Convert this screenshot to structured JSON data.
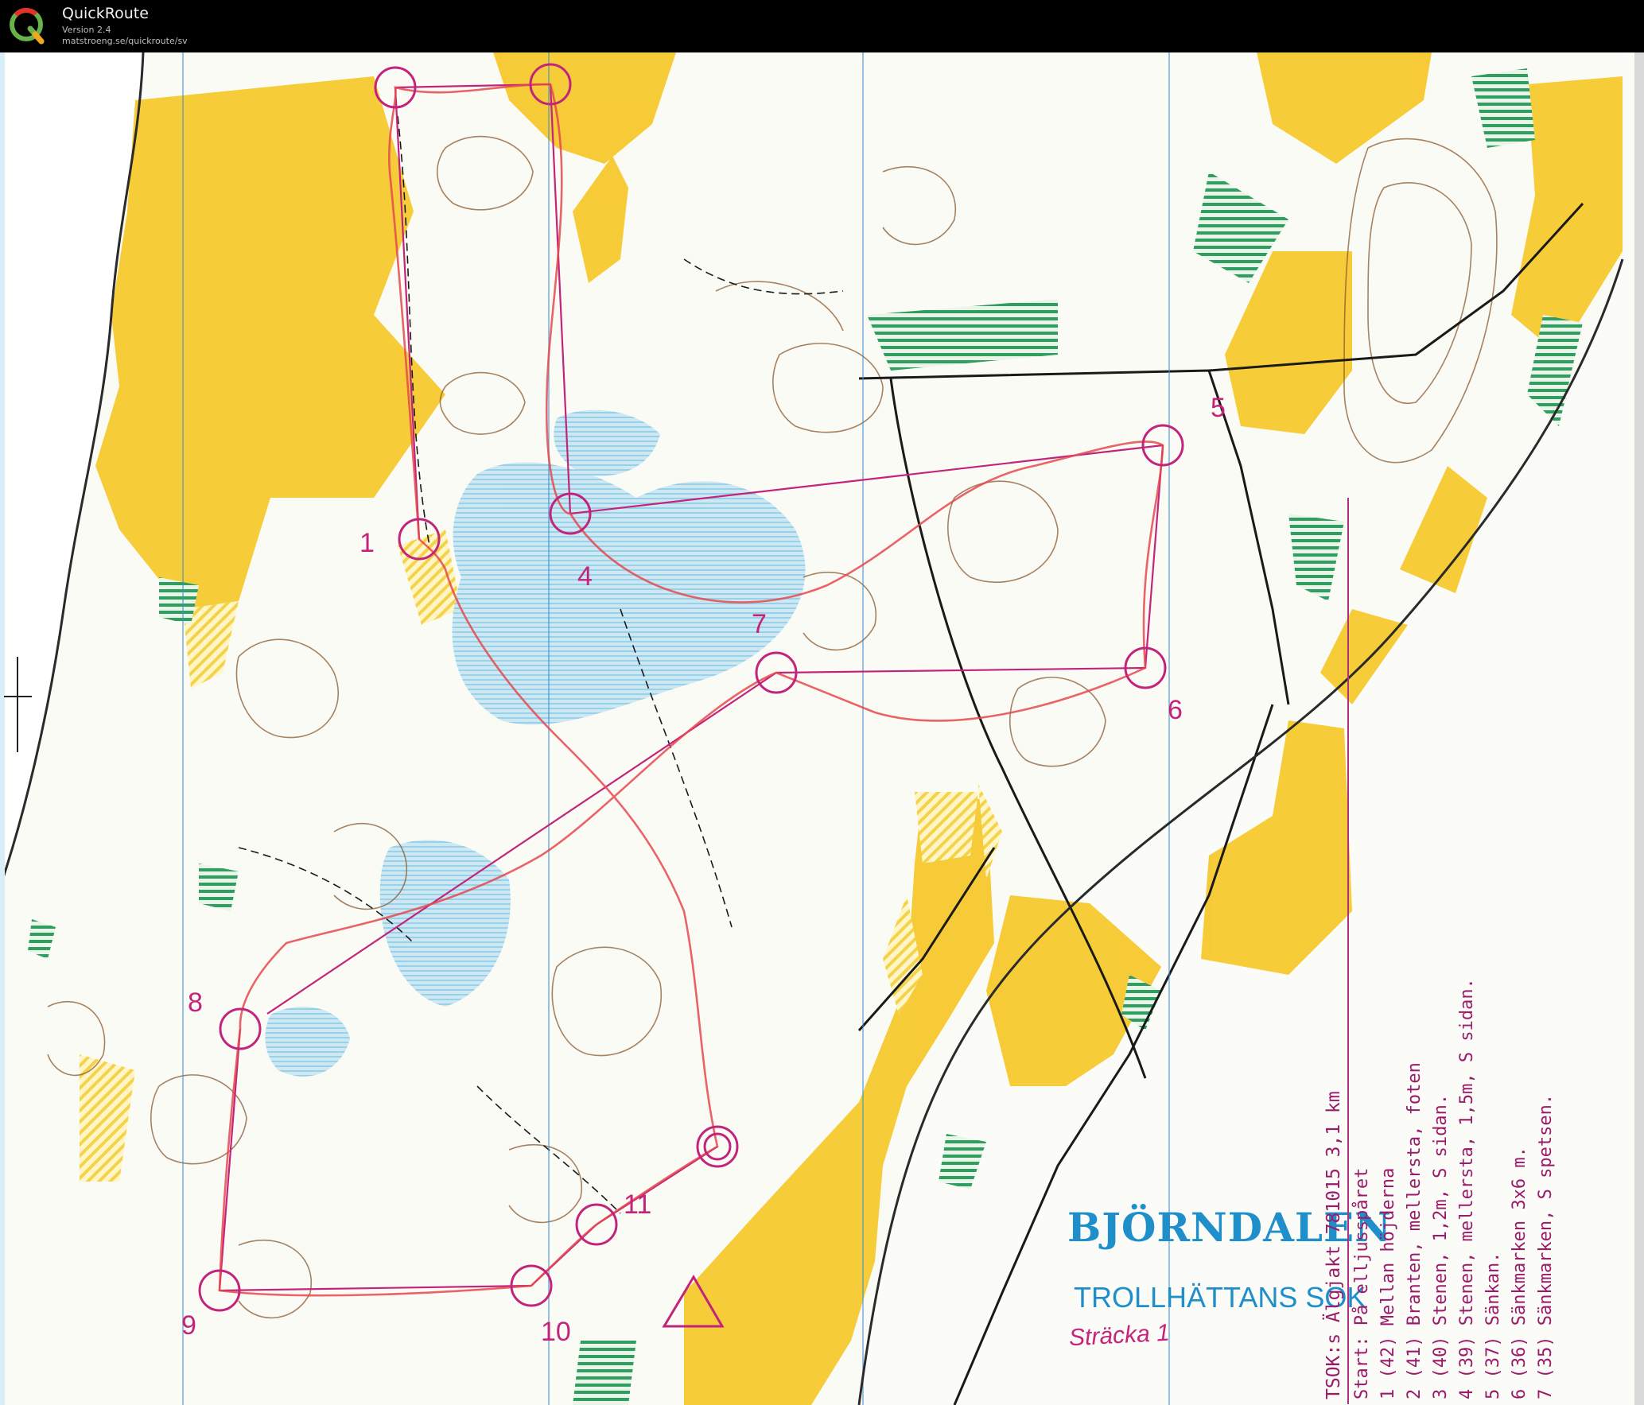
{
  "app": {
    "title": "QuickRoute",
    "version": "Version 2.4",
    "url": "matstroeng.se/quickroute/sv"
  },
  "map": {
    "title": "BJÖRNDALEN",
    "club": "TROLLHÄTTANS SOK",
    "leg_label": "Sträcka 1",
    "colors": {
      "open_land": "#f6c92d",
      "rough_open": "#fbe88e",
      "marsh": "#a9d8ec",
      "green": "#2f9e5e",
      "contour": "#8a5a2f",
      "course": "#c3247b",
      "route": "#e5484d",
      "text_blue": "#1f8fcc"
    },
    "description": {
      "header": "TSOK:s Älgjakt 781015 3,1 km",
      "rows": [
        "Start: På elljusspåret",
        "1 (42) Mellan höjderna",
        "2 (41) Branten, mellersta, foten",
        "3 (40) Stenen, 1,2m, S sidan.",
        "4 (39) Stenen, mellersta, 1,5m, S sidan.",
        "5 (37) Sänkan.",
        "6 (36) Sänkmarken 3x6 m.",
        "7 (35) Sänkmarken, S spetsen."
      ]
    },
    "controls": [
      "1",
      "4",
      "5",
      "6",
      "7",
      "8",
      "9",
      "10",
      "11"
    ]
  }
}
